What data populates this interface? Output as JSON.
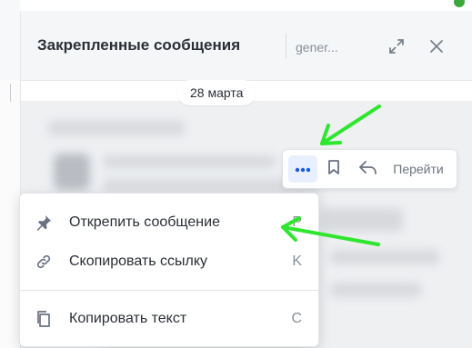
{
  "panel": {
    "title": "Закрепленные сообщения",
    "channel": "gener..."
  },
  "messages": {
    "date_label": "28 марта"
  },
  "toolbar": {
    "more_icon": "more-horizontal-icon",
    "bookmark_icon": "bookmark-icon",
    "reply_icon": "reply-icon",
    "goto_label": "Перейти"
  },
  "context_menu": {
    "items": [
      {
        "icon": "pin-icon",
        "label": "Открепить сообщение",
        "shortcut": "P"
      },
      {
        "icon": "link-icon",
        "label": "Скопировать ссылку",
        "shortcut": "K"
      },
      {
        "icon": "copy-icon",
        "label": "Копировать текст",
        "shortcut": "C"
      }
    ]
  },
  "colors": {
    "accent": "#1d5bd6",
    "annotation_arrow": "#2ee62e",
    "status_online": "#3aa83a"
  }
}
